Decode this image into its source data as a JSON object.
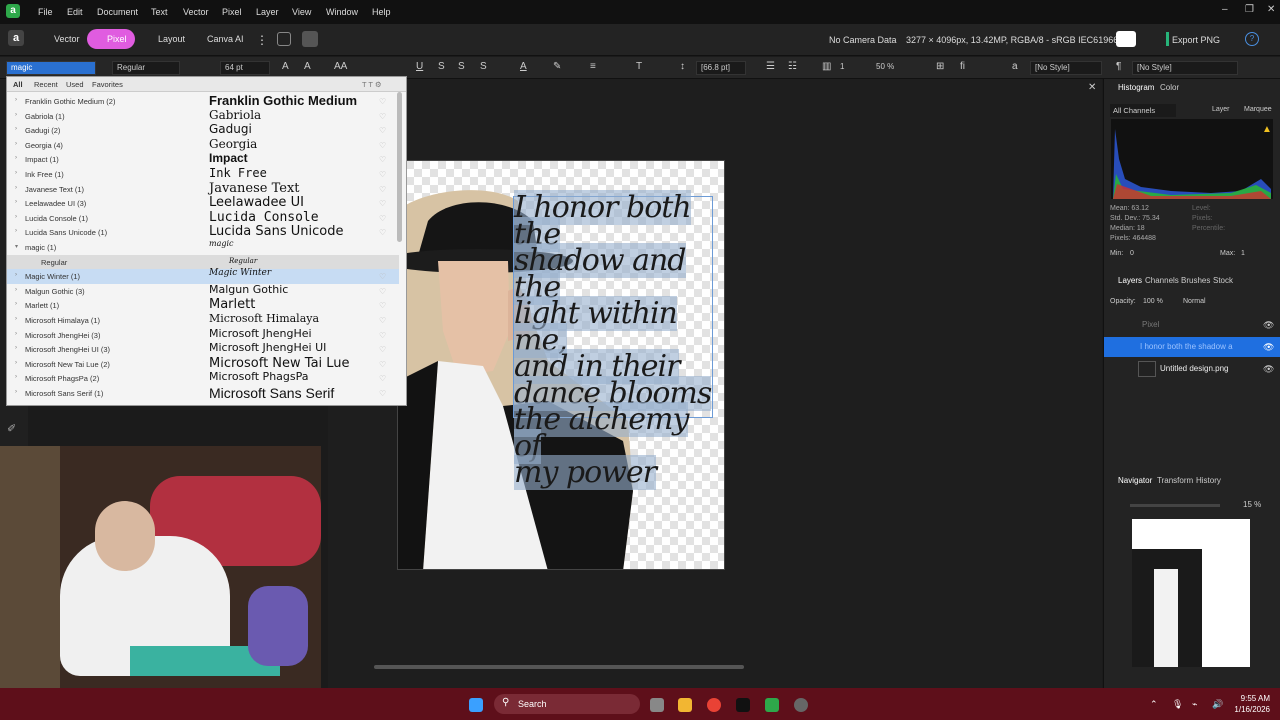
{
  "menu": [
    "File",
    "Edit",
    "Document",
    "Text",
    "Vector",
    "Pixel",
    "Layer",
    "View",
    "Window",
    "Help"
  ],
  "toolbar": {
    "vector": "Vector",
    "pixel": "Pixel",
    "layout": "Layout",
    "canva": "Canva AI",
    "camera": "No Camera Data",
    "docinfo": "3277 × 4096px, 13.42MP, RGBA/8 - sRGB IEC61966-2.1",
    "export": "Export PNG"
  },
  "ctx": {
    "font_search": "magic",
    "style": "Regular",
    "size": "64 pt",
    "tracking": "[66.8 pt]",
    "col": "1",
    "zoom": "50 %",
    "para_style": "[No Style]",
    "char_style": "[No Style]"
  },
  "fontpanel": {
    "tabs": [
      "All",
      "Recent",
      "Used",
      "Favorites"
    ],
    "fonts": [
      {
        "name": "Franklin Gothic Medium (2)",
        "preview": "Franklin Gothic Medium",
        "family": "\"Liberation Sans\",sans-serif",
        "weight": "bold",
        "size": "13px"
      },
      {
        "name": "Gabriola (1)",
        "preview": "Gabriola",
        "family": "\"DejaVu Serif\",serif",
        "weight": "normal",
        "size": "12px"
      },
      {
        "name": "Gadugi (2)",
        "preview": "Gadugi",
        "family": "\"DejaVu Sans\",sans-serif",
        "weight": "normal",
        "size": "12px"
      },
      {
        "name": "Georgia (4)",
        "preview": "Georgia",
        "family": "\"DejaVu Serif\",serif",
        "weight": "normal",
        "size": "12px"
      },
      {
        "name": "Impact (1)",
        "preview": "Impact",
        "family": "\"Liberation Sans\",sans-serif",
        "weight": "bold",
        "size": "12px"
      },
      {
        "name": "Ink Free (1)",
        "preview": "Ink Free",
        "family": "\"DejaVu Sans Mono\",monospace",
        "weight": "normal",
        "size": "12px"
      },
      {
        "name": "Javanese Text (1)",
        "preview": "Javanese Text",
        "family": "\"DejaVu Serif\",serif",
        "weight": "normal",
        "size": "13px"
      },
      {
        "name": "Leelawadee UI (3)",
        "preview": "Leelawadee UI",
        "family": "\"DejaVu Sans\",sans-serif",
        "weight": "normal",
        "size": "13px"
      },
      {
        "name": "Lucida Console (1)",
        "preview": "Lucida Console",
        "family": "\"DejaVu Sans Mono\",monospace",
        "weight": "normal",
        "size": "13px"
      },
      {
        "name": "Lucida Sans Unicode (1)",
        "preview": "Lucida Sans Unicode",
        "family": "\"DejaVu Sans\",sans-serif",
        "weight": "normal",
        "size": "13px"
      },
      {
        "name": "magic (1)",
        "preview": "magic",
        "family": "\"DejaVu Serif\",serif",
        "weight": "normal",
        "size": "8px",
        "expanded": true
      },
      {
        "name": "Regular",
        "preview": "Regular",
        "family": "\"DejaVu Serif\",serif",
        "weight": "normal",
        "size": "7px",
        "sub": true
      },
      {
        "name": "Magic Winter (1)",
        "preview": "Magic Winter",
        "family": "\"DejaVu Serif\",serif",
        "weight": "normal",
        "size": "9px",
        "selected": true
      },
      {
        "name": "Malgun Gothic (3)",
        "preview": "Malgun Gothic",
        "family": "\"DejaVu Sans\",sans-serif",
        "weight": "normal",
        "size": "11px"
      },
      {
        "name": "Marlett (1)",
        "preview": "Marlett",
        "family": "\"DejaVu Sans\",sans-serif",
        "weight": "normal",
        "size": "13px"
      },
      {
        "name": "Microsoft Himalaya (1)",
        "preview": "Microsoft Himalaya",
        "family": "\"DejaVu Serif\",serif",
        "weight": "normal",
        "size": "11px"
      },
      {
        "name": "Microsoft JhengHei (3)",
        "preview": "Microsoft JhengHei",
        "family": "\"DejaVu Sans\",sans-serif",
        "weight": "normal",
        "size": "11px"
      },
      {
        "name": "Microsoft JhengHei UI (3)",
        "preview": "Microsoft JhengHei UI",
        "family": "\"DejaVu Sans\",sans-serif",
        "weight": "normal",
        "size": "11px"
      },
      {
        "name": "Microsoft New Tai Lue (2)",
        "preview": "Microsoft New Tai Lue",
        "family": "\"DejaVu Sans\",sans-serif",
        "weight": "normal",
        "size": "13px"
      },
      {
        "name": "Microsoft PhagsPa (2)",
        "preview": "Microsoft PhagsPa",
        "family": "\"DejaVu Sans\",sans-serif",
        "weight": "normal",
        "size": "11px"
      },
      {
        "name": "Microsoft Sans Serif (1)",
        "preview": "Microsoft Sans Serif",
        "family": "\"Liberation Sans\",sans-serif",
        "weight": "normal",
        "size": "14px"
      }
    ]
  },
  "canvas": {
    "text_lines": [
      "I honor both the",
      "shadow and the",
      "light within me,",
      "and in their",
      "dance blooms",
      "the alchemy of",
      "my power"
    ]
  },
  "histogram": {
    "tabs": [
      "Histogram",
      "Color"
    ],
    "channels": "All Channels",
    "layer": "Layer",
    "marquee": "Marquee",
    "stats": [
      "Mean: 63.12",
      "Std. Dev.: 75.34",
      "Median: 18",
      "Pixels: 464488"
    ],
    "stats2": [
      "Level:",
      "Pixels:",
      "Percentile:"
    ],
    "min_label": "Min:",
    "min": "0",
    "max_label": "Max:",
    "max": "1"
  },
  "layers": {
    "tabs": [
      "Layers",
      "Channels",
      "Brushes",
      "Stock"
    ],
    "opacity_label": "Opacity:",
    "opacity": "100 %",
    "blend": "Normal",
    "items": [
      {
        "name": "Pixel"
      },
      {
        "name": "I honor both the shadow a"
      },
      {
        "name": "Untitled design.png"
      }
    ]
  },
  "navigator": {
    "tabs": [
      "Navigator",
      "Transform",
      "History"
    ],
    "zoom": "15 %"
  },
  "taskbar": {
    "search": "Search",
    "time": "9:55 AM",
    "date": "1/16/2026"
  },
  "colors": {
    "accent": "#e05ce0",
    "titlebar": "#111111",
    "taskbar": "#5e0f1a",
    "selection": "#0a84ff"
  }
}
